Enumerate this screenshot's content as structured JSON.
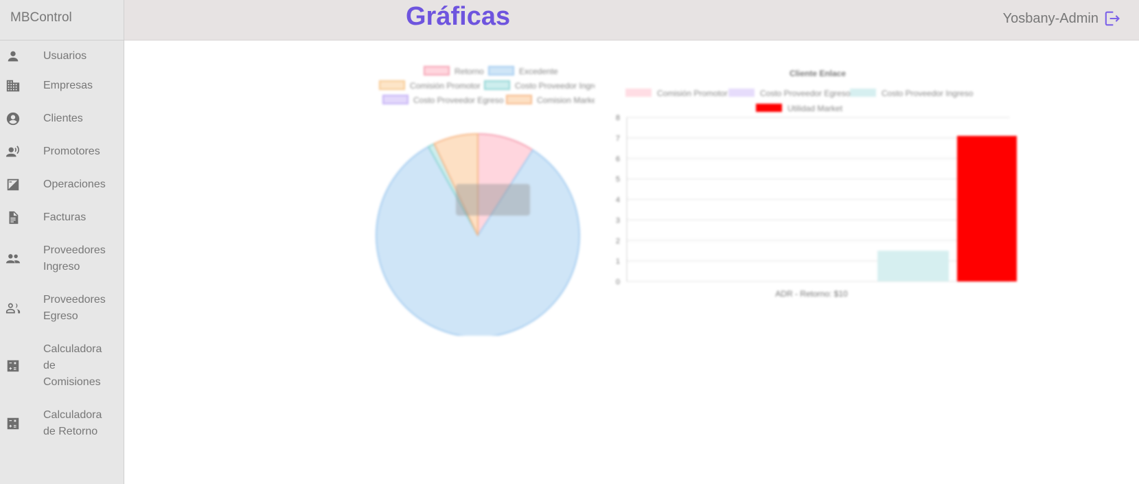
{
  "app": {
    "brand": "MBControl",
    "page_title": "Gráficas",
    "user": "Yosbany-Admin"
  },
  "sidebar": {
    "items": [
      {
        "label": "Usuarios",
        "icon": "person-icon"
      },
      {
        "label": "Empresas",
        "icon": "building-icon"
      },
      {
        "label": "Clientes",
        "icon": "account-circle-icon"
      },
      {
        "label": "Promotores",
        "icon": "record-voice-icon"
      },
      {
        "label": "Operaciones",
        "icon": "exposure-icon"
      },
      {
        "label": "Facturas",
        "icon": "document-icon"
      },
      {
        "label": "Proveedores Ingreso",
        "icon": "group-icon"
      },
      {
        "label": "Proveedores Egreso",
        "icon": "group-outline-icon"
      },
      {
        "label": "Calculadora de Comisiones",
        "icon": "calculate-icon"
      },
      {
        "label": "Calculadora de Retorno",
        "icon": "calculate-icon"
      }
    ]
  },
  "colors": {
    "accent": "#6e54de",
    "sidebar_bg": "#e7e7e7",
    "topbar_bg": "#e7e3e3"
  },
  "chart_data": [
    {
      "type": "pie",
      "title": "",
      "legend_position": "top",
      "labels": [
        "Retorno",
        "Excedente",
        "Comisión Promotor",
        "Costo Proveedor Ingreso",
        "Costo Proveedor Egreso",
        "Comision Market"
      ],
      "values": [
        9,
        82,
        0,
        1,
        0,
        7
      ],
      "colors": [
        "#ffd6de",
        "#cfe5f7",
        "#fde5c8",
        "#cdeeee",
        "#e3d8fb",
        "#fde0c4"
      ],
      "border_colors": [
        "#f5a3b4",
        "#a6cdf0",
        "#f7c88f",
        "#8fd4d4",
        "#c4b0f5",
        "#f7b98a"
      ]
    },
    {
      "type": "bar",
      "title": "Cliente Enlace",
      "legend_position": "top",
      "categories": [
        "ADR - Retorno: $10"
      ],
      "series": [
        {
          "name": "Comisión Promotor",
          "values": [
            0
          ],
          "color": "#ffdde4"
        },
        {
          "name": "Costo Proveedor Egreso",
          "values": [
            0
          ],
          "color": "#e6dcfb"
        },
        {
          "name": "Costo Proveedor Ingreso",
          "values": [
            1.5
          ],
          "color": "#d6eff0"
        },
        {
          "name": "Utilidad Market",
          "values": [
            7.1
          ],
          "color": "#ff0000"
        }
      ],
      "ylim": [
        0,
        8
      ],
      "yticks": [
        "0",
        "1",
        "2",
        "3",
        "4",
        "5",
        "6",
        "7",
        "8"
      ],
      "grid": true
    }
  ]
}
